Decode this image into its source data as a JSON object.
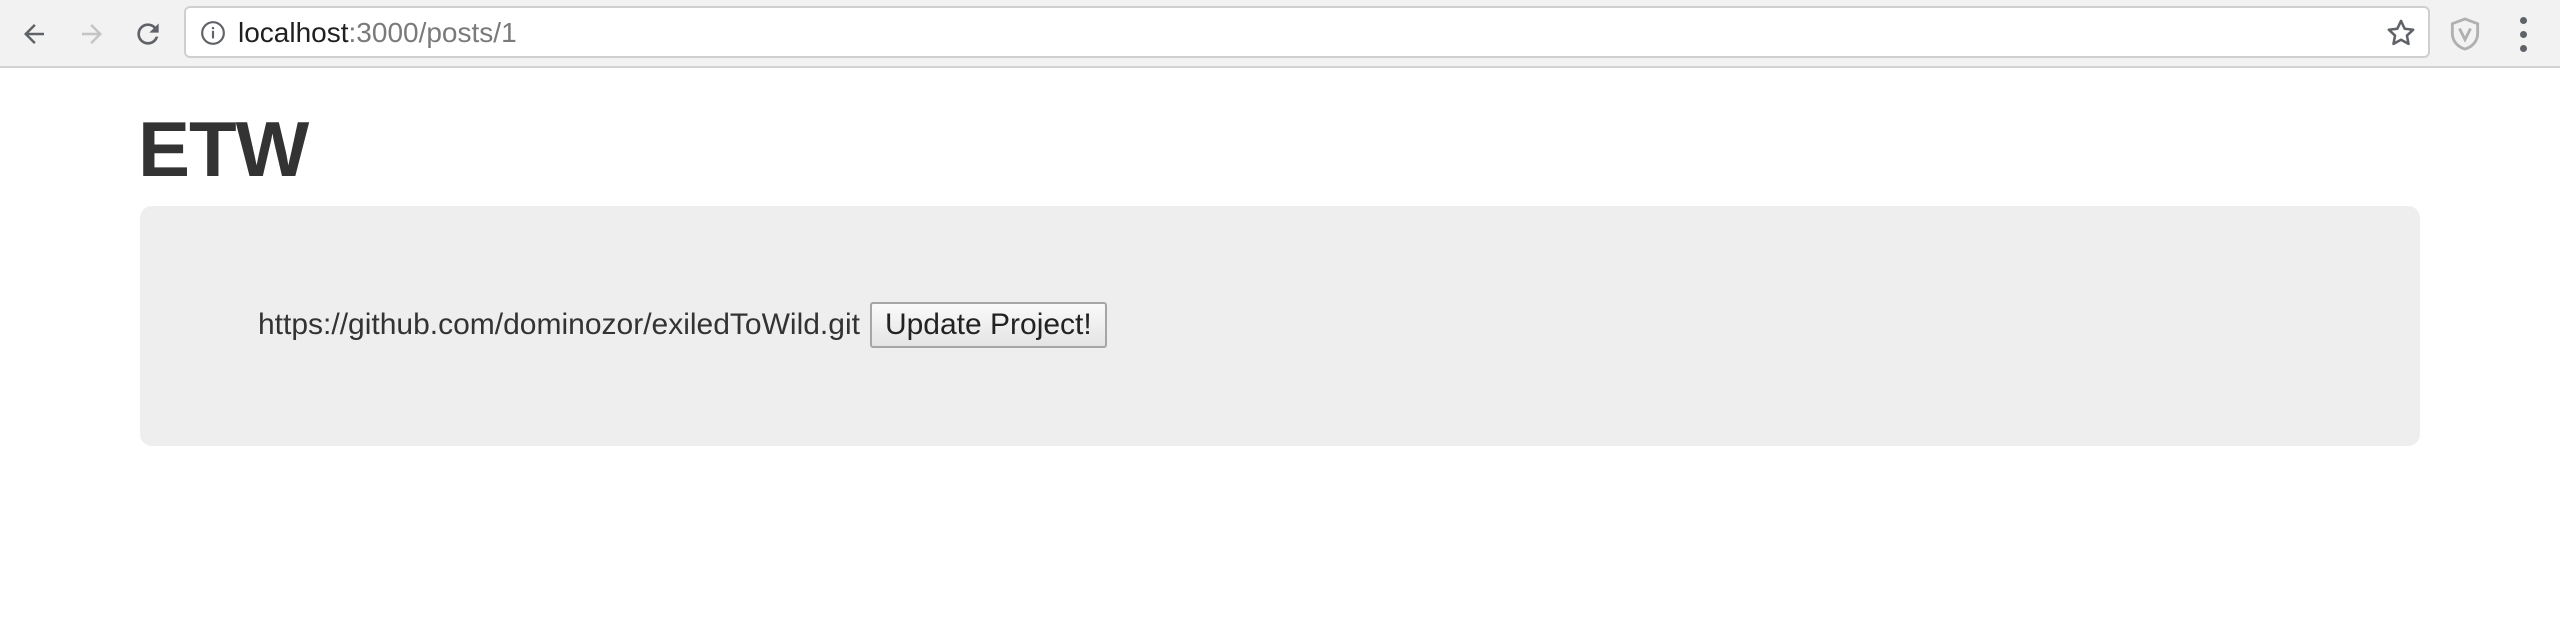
{
  "browser": {
    "url_host": "localhost",
    "url_path": ":3000/posts/1",
    "icons": {
      "back": "back-arrow-icon",
      "forward": "forward-arrow-icon",
      "reload": "reload-icon",
      "info": "info-icon",
      "bookmark": "star-icon",
      "extension": "shield-icon",
      "menu": "more-vert-icon"
    }
  },
  "page": {
    "title": "ETW",
    "project_url": "https://github.com/dominozor/exiledToWild.git",
    "update_button_label": "Update Project!"
  },
  "colors": {
    "title_text": "#333333",
    "panel_background": "#eeeeee",
    "toolbar_background": "#f2f2f2"
  }
}
